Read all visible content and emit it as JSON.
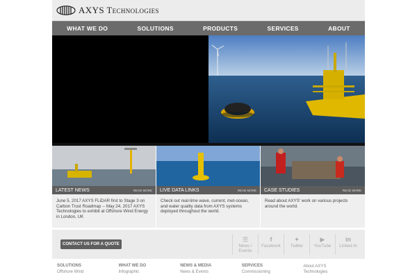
{
  "header": {
    "logo_text_part1": "AXYS",
    "logo_text_part2": "Technologies"
  },
  "nav": {
    "items": [
      "WHAT WE DO",
      "SOLUTIONS",
      "PRODUCTS",
      "SERVICES",
      "ABOUT"
    ]
  },
  "cards": [
    {
      "title": "LATEST NEWS",
      "more": "READ MORE",
      "text": "June 5, 2017 AXYS FLiDAR first to Stage 3 on Carbon Trust Roadmap -- May 24, 2017 AXYS Technologies to exhibit at Offshore Wind Energy in London, UK"
    },
    {
      "title": "LIVE DATA LINKS",
      "more": "READ MORE",
      "text": "Check out real-time wave, current, met-ocean, and water quality data from AXYS systems deployed throughout the world."
    },
    {
      "title": "CASE STUDIES",
      "more": "READ MORE",
      "text": "Read about AXYS' work on various projects around the world."
    }
  ],
  "cta": {
    "button_label": "CONTACT US FOR A QUOTE"
  },
  "socials": [
    {
      "label": "News / Events",
      "icon": "rss-icon"
    },
    {
      "label": "Facebook",
      "icon": "facebook-icon"
    },
    {
      "label": "Twitter",
      "icon": "twitter-icon"
    },
    {
      "label": "YouTube",
      "icon": "youtube-icon"
    },
    {
      "label": "Linked In",
      "icon": "linkedin-icon"
    }
  ],
  "footer": {
    "col1": {
      "heading": "SOLUTIONS",
      "link": "Offshore Wind"
    },
    "col2": {
      "heading": "WHAT WE DO",
      "link": "Infographic"
    },
    "col3": {
      "heading": "NEWS & MEDIA",
      "link": "News & Events"
    },
    "col4": {
      "heading": "SERVICES",
      "link": "Commissioning"
    },
    "col5": {
      "link1": "About AXYS",
      "link2": "Technologies"
    }
  },
  "colors": {
    "nav_bg": "#6b6b6b",
    "card_bar": "#5d5d5d",
    "cta_button": "#5e5e5e"
  }
}
